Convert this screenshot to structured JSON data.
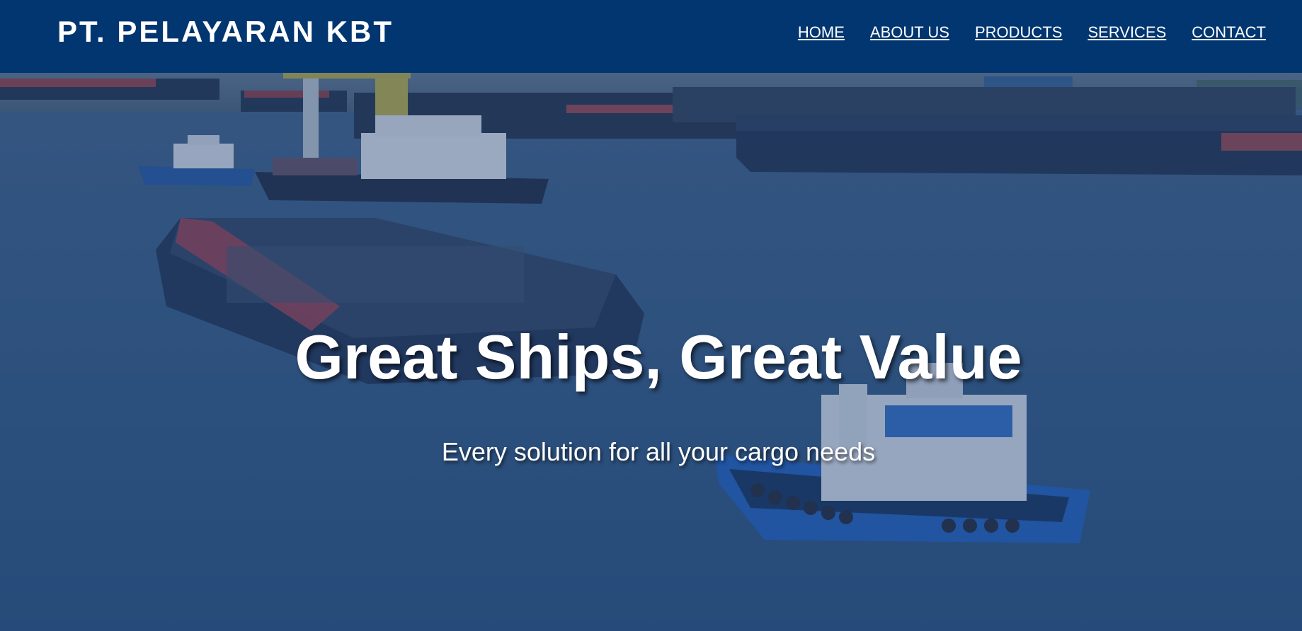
{
  "header": {
    "brand": "PT. PELAYARAN KBT",
    "nav": [
      "HOME",
      "ABOUT US",
      "PRODUCTS",
      "SERVICES",
      "CONTACT"
    ]
  },
  "hero": {
    "headline": "Great Ships, Great Value",
    "tagline": "Every solution for all your cargo needs",
    "image": "harbor-tugboats-barges"
  },
  "colors": {
    "navbar": "#023670",
    "text": "#ffffff",
    "overlay": "#12346e"
  }
}
